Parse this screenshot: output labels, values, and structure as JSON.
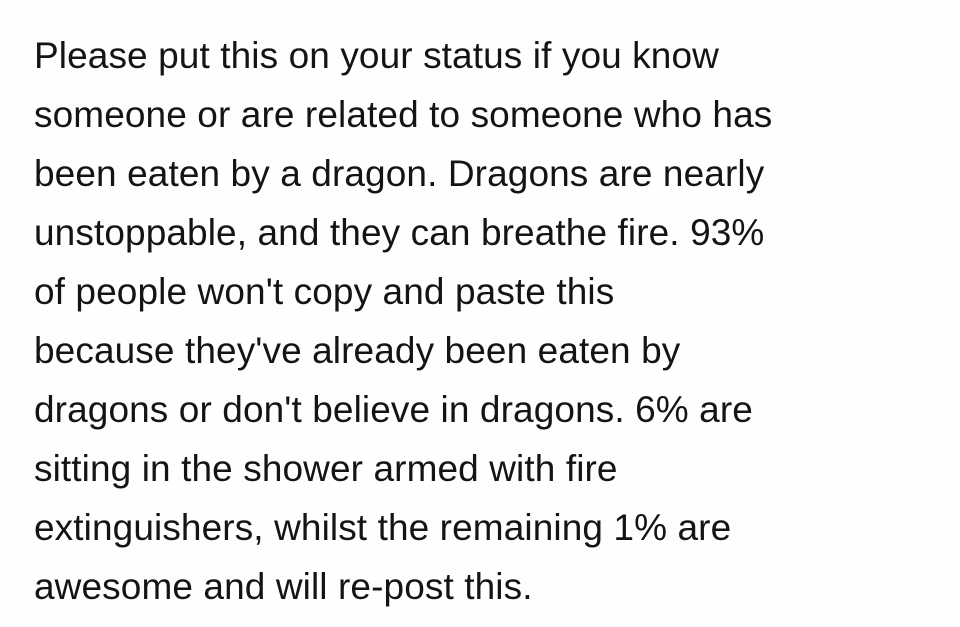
{
  "post": {
    "lines": [
      "Please put this on your status if you know",
      "someone or are related to someone who has",
      "been eaten by a dragon. Dragons are nearly",
      "unstoppable, and they can breathe fire. 93%",
      "of people won't copy and paste this",
      "because they've already been eaten by",
      "dragons or don't believe in dragons. 6% are",
      "sitting in the shower armed with fire",
      "extinguishers, whilst the remaining 1% are",
      "awesome and will re-post this."
    ]
  },
  "colors": {
    "background": "#ffffff",
    "text": "#141414"
  }
}
